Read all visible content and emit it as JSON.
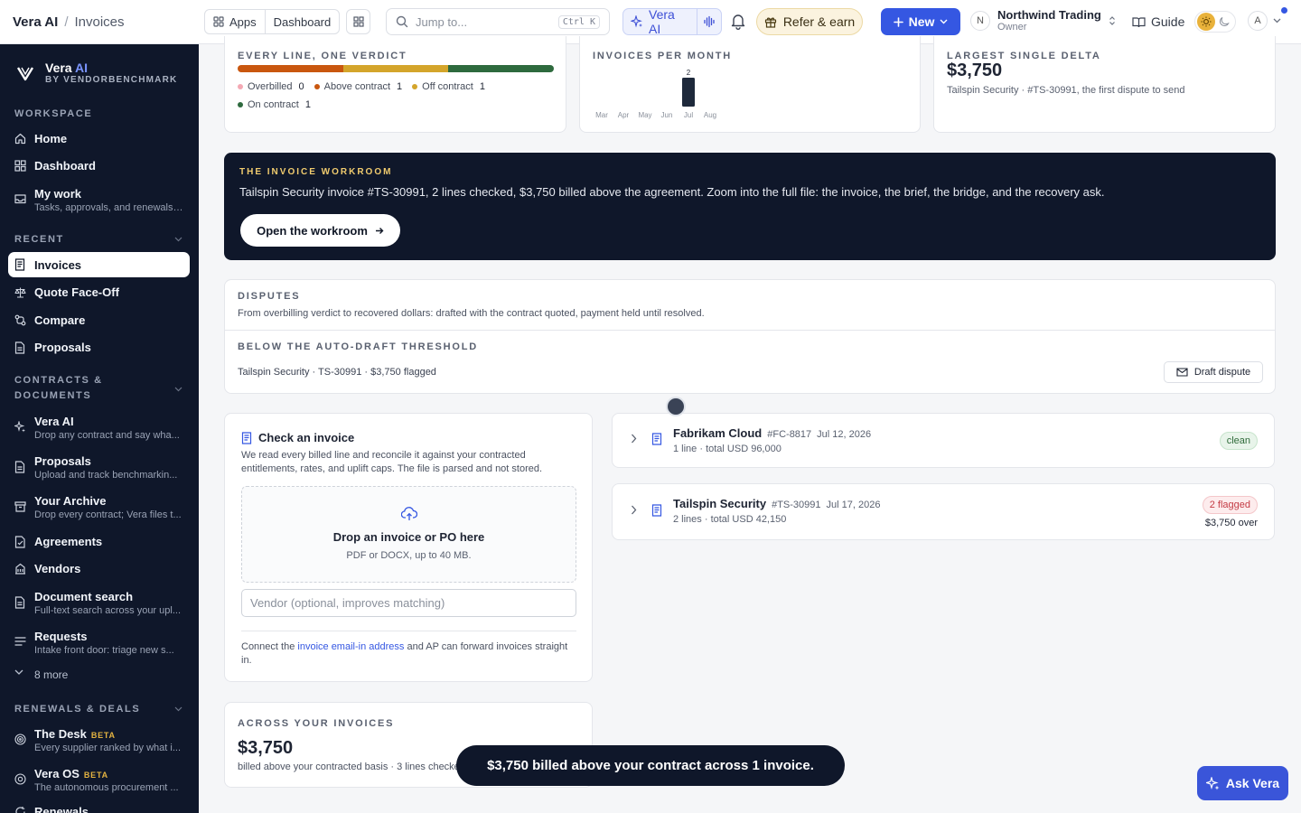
{
  "topbar": {
    "app_name": "Vera AI",
    "separator": "/",
    "page_name": "Invoices",
    "apps_label": "Apps",
    "dashboard_label": "Dashboard",
    "search_placeholder": "Jump to...",
    "search_shortcut": "Ctrl K",
    "vera_label": "Vera AI",
    "refer_label": "Refer & earn",
    "new_label": "New",
    "org_initial": "N",
    "org_name": "Northwind Trading",
    "org_role": "Owner",
    "guide_label": "Guide",
    "user_initial": "A"
  },
  "sidebar": {
    "brand_title": "Vera",
    "brand_accent": "AI",
    "brand_sub": "BY VENDORBENCHMARK",
    "workspace_label": "WORKSPACE",
    "workspace_items": [
      {
        "label": "Home",
        "sub": ""
      },
      {
        "label": "Dashboard",
        "sub": ""
      },
      {
        "label": "My work",
        "sub": "Tasks, approvals, and renewals ..."
      }
    ],
    "recent_label": "RECENT",
    "recent_items": [
      {
        "label": "Invoices"
      },
      {
        "label": "Quote Face-Off"
      },
      {
        "label": "Compare"
      },
      {
        "label": "Proposals"
      }
    ],
    "contracts_label_1": "CONTRACTS &",
    "contracts_label_2": "DOCUMENTS",
    "contract_items": [
      {
        "label": "Vera AI",
        "sub": "Drop any contract and say wha..."
      },
      {
        "label": "Proposals",
        "sub": "Upload and track benchmarkin..."
      },
      {
        "label": "Your Archive",
        "sub": "Drop every contract; Vera files t..."
      },
      {
        "label": "Agreements",
        "sub": ""
      },
      {
        "label": "Vendors",
        "sub": ""
      },
      {
        "label": "Document search",
        "sub": "Full-text search across your upl..."
      },
      {
        "label": "Requests",
        "sub": "Intake front door: triage new s..."
      }
    ],
    "more_label": "8 more",
    "renewals_label": "RENEWALS & DEALS",
    "renewal_items": [
      {
        "label": "The Desk",
        "badge": "BETA",
        "sub": "Every supplier ranked by what i..."
      },
      {
        "label": "Vera OS",
        "badge": "BETA",
        "sub": "The autonomous procurement ..."
      },
      {
        "label": "Renewals",
        "sub": ""
      }
    ]
  },
  "verdict_card": {
    "kicker": "EVERY LINE, ONE VERDICT",
    "legend": [
      {
        "label": "Overbilled",
        "count": "0",
        "color": "#f4a9b4"
      },
      {
        "label": "Above contract",
        "count": "1",
        "color": "#c9570f"
      },
      {
        "label": "Off contract",
        "count": "1",
        "color": "#d4a52b"
      },
      {
        "label": "On contract",
        "count": "1",
        "color": "#2e6a3e"
      }
    ]
  },
  "month_card": {
    "kicker": "INVOICES PER MONTH"
  },
  "chart_data": {
    "type": "bar",
    "categories": [
      "Mar",
      "Apr",
      "May",
      "Jun",
      "Jul",
      "Aug"
    ],
    "values": [
      0,
      0,
      0,
      0,
      2,
      0
    ],
    "data_labels": [
      "",
      "",
      "",
      "",
      "2",
      ""
    ],
    "color": "#1e293b"
  },
  "delta_card": {
    "kicker": "LARGEST SINGLE DELTA",
    "value": "$3,750",
    "sub": "Tailspin Security · #TS-30991, the first dispute to send"
  },
  "workroom": {
    "kicker": "THE INVOICE WORKROOM",
    "desc": "Tailspin Security invoice #TS-30991, 2 lines checked, $3,750 billed above the agreement. Zoom into the full file: the invoice, the brief, the bridge, and the recovery ask.",
    "button": "Open the workroom"
  },
  "disputes": {
    "kicker": "DISPUTES",
    "desc": "From overbilling verdict to recovered dollars: drafted with the contract quoted, payment held until resolved.",
    "threshold_kicker": "BELOW THE AUTO-DRAFT THRESHOLD",
    "row": "Tailspin Security · TS-30991 · $3,750 flagged",
    "draft_button": "Draft dispute"
  },
  "check": {
    "title": "Check an invoice",
    "desc": "We read every billed line and reconcile it against your contracted entitlements, rates, and uplift caps. The file is parsed and not stored.",
    "drop_title": "Drop an invoice or PO here",
    "drop_sub": "PDF or DOCX, up to 40 MB.",
    "vendor_placeholder": "Vendor (optional, improves matching)",
    "connect_pre": "Connect the",
    "connect_link": "invoice email-in address",
    "connect_post": "and AP can forward invoices straight in."
  },
  "invoices": [
    {
      "vendor": "Fabrikam Cloud",
      "id": "#FC-8817",
      "date": "Jul 12, 2026",
      "summary": "1 line · total USD 96,000",
      "status": "clean",
      "over": ""
    },
    {
      "vendor": "Tailspin Security",
      "id": "#TS-30991",
      "date": "Jul 17, 2026",
      "summary": "2 lines · total USD 42,150",
      "status": "2 flagged",
      "over": "$3,750 over"
    }
  ],
  "across": {
    "kicker": "ACROSS YOUR INVOICES",
    "value": "$3,750",
    "sub": "billed above your contracted basis · 3 lines checked"
  },
  "toast": "$3,750 billed above your contract across 1 invoice.",
  "ask_vera": "Ask Vera",
  "colors": {
    "sidebar_bg": "#0f172a",
    "accent": "#3557e2",
    "workroom_kicker": "#f0cb6e"
  }
}
